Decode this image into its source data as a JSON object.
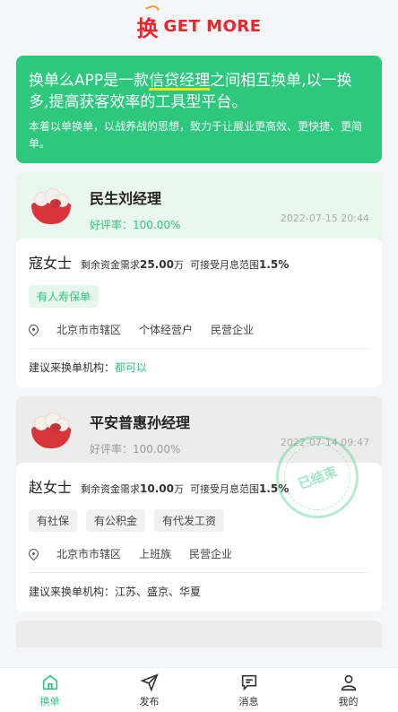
{
  "logo": {
    "mark": "换",
    "text": "GET MORE"
  },
  "banner": {
    "title_prefix": "换单么APP是一款",
    "title_highlight": "信贷经理",
    "title_suffix": "之间相互换单,以一换多,提高获客效率的工具型平台。",
    "desc": "本着以单换单，以战养战的思想，致力于让展业更高效、更快捷、更简单。"
  },
  "cards": [
    {
      "manager": "民生刘经理",
      "rating_label": "好评率：",
      "rating": "100.00%",
      "date": "2022-07-15 20:44",
      "person": "寇女士",
      "req_label": "剩余资金需求",
      "req_amount": "25.00",
      "req_unit": "万",
      "range_label": "可接受月息范围",
      "range_value": "1.5%",
      "tags": [
        "有人寿保单"
      ],
      "location": "北京市市辖区",
      "job": "个体经营户",
      "company": "民营企业",
      "suggest_label": "建议来换单机构：",
      "suggest_value": "都可以",
      "status": ""
    },
    {
      "manager": "平安普惠孙经理",
      "rating_label": "好评率：",
      "rating": "100.00%",
      "date": "2022-07-14 09:47",
      "person": "赵女士",
      "req_label": "剩余资金需求",
      "req_amount": "10.00",
      "req_unit": "万",
      "range_label": "可接受月息范围",
      "range_value": "1.5%",
      "tags": [
        "有社保",
        "有公积金",
        "有代发工资"
      ],
      "location": "北京市市辖区",
      "job": "上班族",
      "company": "民营企业",
      "suggest_label": "建议来换单机构：",
      "suggest_value": "江苏、盛京、华夏",
      "status": "已结束"
    }
  ],
  "tabbar": [
    {
      "label": "换单",
      "icon": "home-icon",
      "active": true
    },
    {
      "label": "发布",
      "icon": "send-icon",
      "active": false
    },
    {
      "label": "消息",
      "icon": "message-icon",
      "active": false
    },
    {
      "label": "我的",
      "icon": "user-icon",
      "active": false
    }
  ],
  "colors": {
    "accent": "#2ec77e",
    "brand": "#e8262c"
  }
}
